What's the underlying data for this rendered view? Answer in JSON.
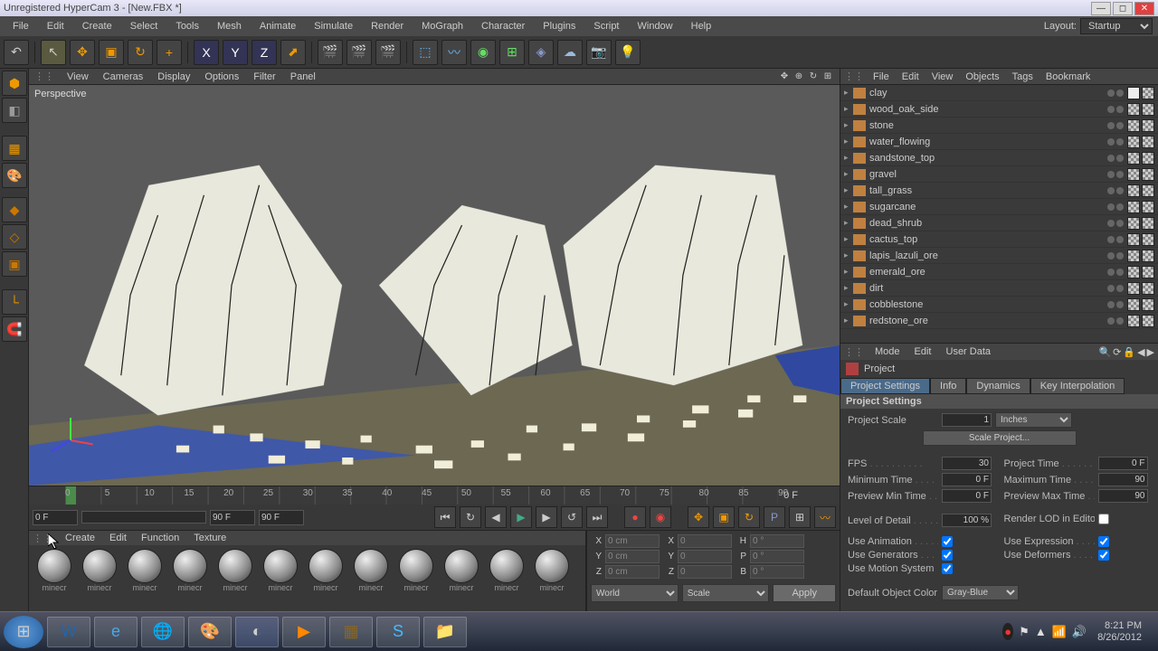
{
  "window": {
    "title": "Unregistered HyperCam 3 - [New.FBX *]"
  },
  "menubar": [
    "File",
    "Edit",
    "Create",
    "Select",
    "Tools",
    "Mesh",
    "Animate",
    "Simulate",
    "Render",
    "MoGraph",
    "Character",
    "Plugins",
    "Script",
    "Window",
    "Help"
  ],
  "layout": {
    "label": "Layout:",
    "value": "Startup"
  },
  "viewport_menu": [
    "View",
    "Cameras",
    "Display",
    "Options",
    "Filter",
    "Panel"
  ],
  "viewport_label": "Perspective",
  "object_menu": [
    "File",
    "Edit",
    "View",
    "Objects",
    "Tags",
    "Bookmark"
  ],
  "objects": [
    "clay",
    "wood_oak_side",
    "stone",
    "water_flowing",
    "sandstone_top",
    "gravel",
    "tall_grass",
    "sugarcane",
    "dead_shrub",
    "cactus_top",
    "lapis_lazuli_ore",
    "emerald_ore",
    "dirt",
    "cobblestone",
    "redstone_ore"
  ],
  "attr_menu": [
    "Mode",
    "Edit",
    "User Data"
  ],
  "attr_title": "Project",
  "attr_tabs": [
    "Project Settings",
    "Info",
    "Dynamics",
    "Key Interpolation"
  ],
  "attr_section": "Project Settings",
  "attr": {
    "project_scale_label": "Project Scale",
    "project_scale": "1",
    "project_scale_unit": "Inches",
    "scale_btn": "Scale Project...",
    "fps_label": "FPS",
    "fps": "30",
    "project_time_label": "Project Time",
    "project_time": "0 F",
    "min_time_label": "Minimum Time",
    "min_time": "0 F",
    "max_time_label": "Maximum Time",
    "max_time": "90",
    "preview_min_label": "Preview Min Time",
    "preview_min": "0 F",
    "preview_max_label": "Preview Max Time",
    "preview_max": "90",
    "lod_label": "Level of Detail",
    "lod": "100 %",
    "render_lod_label": "Render LOD in Editor",
    "use_anim_label": "Use Animation",
    "use_expr_label": "Use Expression",
    "use_gen_label": "Use Generators",
    "use_def_label": "Use Deformers",
    "use_motion_label": "Use Motion System",
    "default_color_label": "Default Object Color",
    "default_color": "Gray-Blue"
  },
  "timeline": {
    "start": "0 F",
    "end": "90 F",
    "end2": "0 F",
    "ticks": [
      0,
      5,
      10,
      15,
      20,
      25,
      30,
      35,
      40,
      45,
      50,
      55,
      60,
      65,
      70,
      75,
      80,
      85,
      90
    ],
    "cur": "0 F",
    "cur2": "90 F"
  },
  "mat_menu": [
    "Create",
    "Edit",
    "Function",
    "Texture"
  ],
  "materials": [
    "minecr",
    "minecr",
    "minecr",
    "minecr",
    "minecr",
    "minecr",
    "minecr",
    "minecr",
    "minecr",
    "minecr",
    "minecr",
    "minecr"
  ],
  "coords": {
    "x": "0 cm",
    "y": "0 cm",
    "z": "0 cm",
    "x2": "0",
    "y2": "0",
    "z2": "0",
    "h": "0 °",
    "p": "0 °",
    "b": "0 °",
    "world": "World",
    "scale": "Scale",
    "apply": "Apply"
  },
  "taskbar": {
    "time": "8:21 PM",
    "date": "8/26/2012"
  }
}
